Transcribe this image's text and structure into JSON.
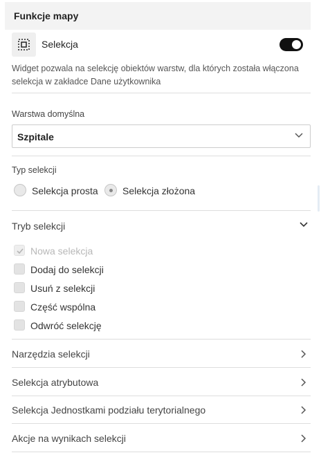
{
  "header": {
    "title": "Funkcje mapy"
  },
  "widget": {
    "icon": "selection-marquee-icon",
    "label": "Selekcja",
    "enabled": true,
    "description": "Widget pozwala na selekcję obiektów warstw, dla których została włączona selekcja w zakładce Dane użytkownika"
  },
  "default_layer": {
    "label": "Warstwa domyślna",
    "value": "Szpitale"
  },
  "selection_type": {
    "label": "Typ selekcji",
    "options": [
      "Selekcja prosta",
      "Selekcja złożona"
    ],
    "selected": "Selekcja złożona"
  },
  "selection_mode": {
    "title": "Tryb selekcji",
    "expanded": true,
    "options": [
      {
        "label": "Nowa selekcja",
        "checked": true,
        "disabled": true
      },
      {
        "label": "Dodaj do selekcji",
        "checked": false,
        "disabled": false
      },
      {
        "label": "Usuń z selekcji",
        "checked": false,
        "disabled": false
      },
      {
        "label": "Część wspólna",
        "checked": false,
        "disabled": false
      },
      {
        "label": "Odwróć selekcję",
        "checked": false,
        "disabled": false
      }
    ]
  },
  "sections": [
    {
      "label": "Narzędzia selekcji"
    },
    {
      "label": "Selekcja atrybutowa"
    },
    {
      "label": "Selekcja Jednostkami podziału terytorialnego"
    },
    {
      "label": "Akcje na wynikach selekcji"
    }
  ],
  "colors": {
    "toggle_on": "#111111",
    "header_bg": "#f3f3f3",
    "divider": "#dddddd"
  }
}
